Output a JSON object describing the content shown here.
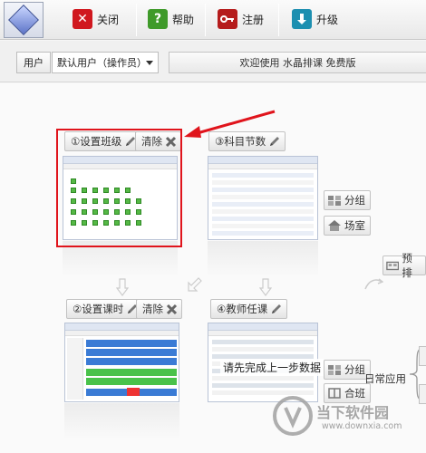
{
  "toolbar": {
    "close_label": "关闭",
    "help_label": "帮助",
    "register_label": "注册",
    "upgrade_label": "升级",
    "help_icon_glyph": "?"
  },
  "userbar": {
    "user_label": "用户",
    "user_value": "默认用户（操作员）",
    "welcome_text": "欢迎使用 水晶排课 免费版"
  },
  "steps": {
    "set_class": "①设置班级",
    "clear1": "清除",
    "subject_hours": "③科目节数",
    "set_hours": "②设置课时",
    "clear2": "清除",
    "teacher_assign": "④教师任课"
  },
  "side": {
    "group1": "分组",
    "room": "场室",
    "prearrange": "预排",
    "group2": "分组",
    "merge": "合班",
    "daily": "日常应用"
  },
  "overlay": {
    "complete_prev": "请先完成上一步数据"
  },
  "watermark": {
    "title": "当下软件园",
    "url": "www.downxia.com"
  },
  "colors": {
    "accent_red": "#e0141c",
    "green": "#55b845",
    "blue": "#3a7bd5"
  }
}
